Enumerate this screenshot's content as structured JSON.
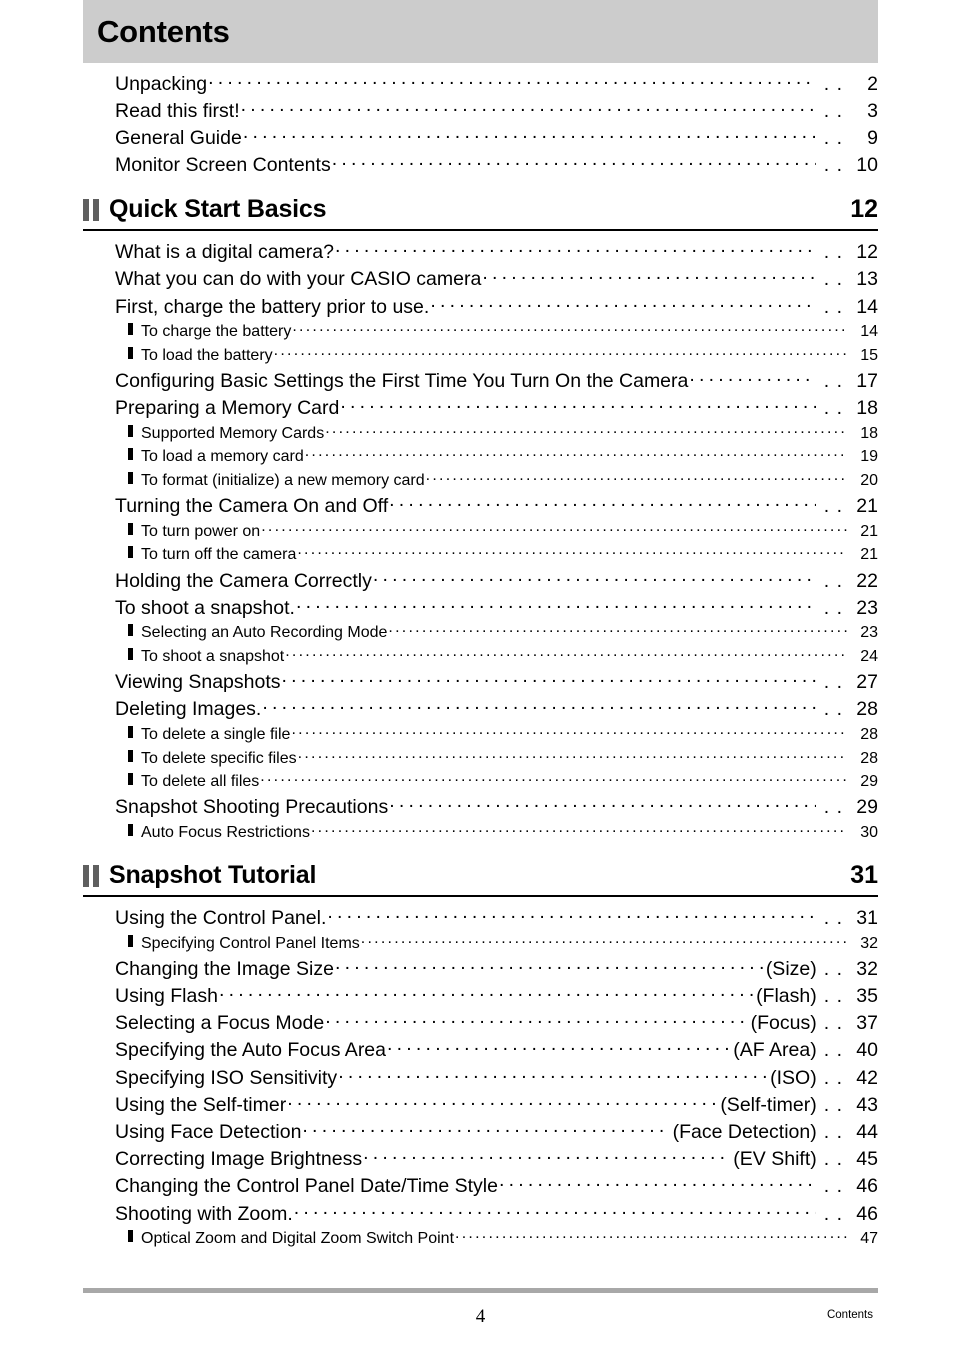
{
  "document": {
    "title": "Contents",
    "footer_page_number": "4",
    "footer_section_label": "Contents"
  },
  "intro_entries": [
    {
      "label": "Unpacking",
      "page": "2",
      "level": 1,
      "annot": ""
    },
    {
      "label": "Read this first!",
      "page": "3",
      "level": 1,
      "annot": ""
    },
    {
      "label": "General Guide",
      "page": "9",
      "level": 1,
      "annot": ""
    },
    {
      "label": "Monitor Screen Contents",
      "page": "10",
      "level": 1,
      "annot": ""
    }
  ],
  "sections": [
    {
      "title": "Quick Start Basics",
      "page": "12",
      "icon": "section-bars-icon",
      "entries": [
        {
          "label": "What is a digital camera?",
          "page": "12",
          "level": 1,
          "annot": ""
        },
        {
          "label": "What you can do with your CASIO camera",
          "page": "13",
          "level": 1,
          "annot": ""
        },
        {
          "label": "First, charge the battery prior to use.",
          "page": "14",
          "level": 1,
          "annot": ""
        },
        {
          "label": "To charge the battery",
          "page": "14",
          "level": 2,
          "annot": ""
        },
        {
          "label": "To load the battery",
          "page": "15",
          "level": 2,
          "annot": ""
        },
        {
          "label": "Configuring Basic Settings the First Time You Turn On the Camera",
          "page": "17",
          "level": 1,
          "annot": ""
        },
        {
          "label": "Preparing a Memory Card",
          "page": "18",
          "level": 1,
          "annot": ""
        },
        {
          "label": "Supported Memory Cards",
          "page": "18",
          "level": 2,
          "annot": ""
        },
        {
          "label": "To load a memory card",
          "page": "19",
          "level": 2,
          "annot": ""
        },
        {
          "label": "To format (initialize) a new memory card",
          "page": "20",
          "level": 2,
          "annot": ""
        },
        {
          "label": "Turning the Camera On and Off",
          "page": "21",
          "level": 1,
          "annot": ""
        },
        {
          "label": "To turn power on",
          "page": "21",
          "level": 2,
          "annot": ""
        },
        {
          "label": "To turn off the camera",
          "page": "21",
          "level": 2,
          "annot": ""
        },
        {
          "label": "Holding the Camera Correctly",
          "page": "22",
          "level": 1,
          "annot": ""
        },
        {
          "label": "To shoot a snapshot.",
          "page": "23",
          "level": 1,
          "annot": ""
        },
        {
          "label": "Selecting an Auto Recording Mode",
          "page": "23",
          "level": 2,
          "annot": ""
        },
        {
          "label": "To shoot a snapshot",
          "page": "24",
          "level": 2,
          "annot": ""
        },
        {
          "label": "Viewing Snapshots",
          "page": "27",
          "level": 1,
          "annot": ""
        },
        {
          "label": "Deleting Images.",
          "page": "28",
          "level": 1,
          "annot": ""
        },
        {
          "label": "To delete a single file",
          "page": "28",
          "level": 2,
          "annot": ""
        },
        {
          "label": "To delete specific files",
          "page": "28",
          "level": 2,
          "annot": ""
        },
        {
          "label": "To delete all files",
          "page": "29",
          "level": 2,
          "annot": ""
        },
        {
          "label": "Snapshot Shooting Precautions",
          "page": "29",
          "level": 1,
          "annot": ""
        },
        {
          "label": "Auto Focus Restrictions",
          "page": "30",
          "level": 2,
          "annot": ""
        }
      ]
    },
    {
      "title": "Snapshot Tutorial",
      "page": "31",
      "icon": "section-bars-icon",
      "entries": [
        {
          "label": "Using the Control Panel.",
          "page": "31",
          "level": 1,
          "annot": ""
        },
        {
          "label": "Specifying Control Panel Items",
          "page": "32",
          "level": 2,
          "annot": ""
        },
        {
          "label": "Changing the Image Size",
          "page": "32",
          "level": 1,
          "annot": "(Size)"
        },
        {
          "label": "Using Flash",
          "page": "35",
          "level": 1,
          "annot": "(Flash)"
        },
        {
          "label": "Selecting a Focus Mode",
          "page": "37",
          "level": 1,
          "annot": "(Focus)"
        },
        {
          "label": "Specifying the Auto Focus Area",
          "page": "40",
          "level": 1,
          "annot": "(AF Area)"
        },
        {
          "label": "Specifying ISO Sensitivity",
          "page": "42",
          "level": 1,
          "annot": "(ISO)"
        },
        {
          "label": "Using the Self-timer",
          "page": "43",
          "level": 1,
          "annot": "(Self-timer)"
        },
        {
          "label": "Using Face Detection",
          "page": "44",
          "level": 1,
          "annot": "(Face Detection)"
        },
        {
          "label": "Correcting Image Brightness",
          "page": "45",
          "level": 1,
          "annot": "(EV Shift)"
        },
        {
          "label": "Changing the Control Panel Date/Time Style",
          "page": "46",
          "level": 1,
          "annot": ""
        },
        {
          "label": "Shooting with Zoom.",
          "page": "46",
          "level": 1,
          "annot": ""
        },
        {
          "label": "Optical Zoom and Digital Zoom Switch Point",
          "page": "47",
          "level": 2,
          "annot": ""
        }
      ]
    }
  ]
}
